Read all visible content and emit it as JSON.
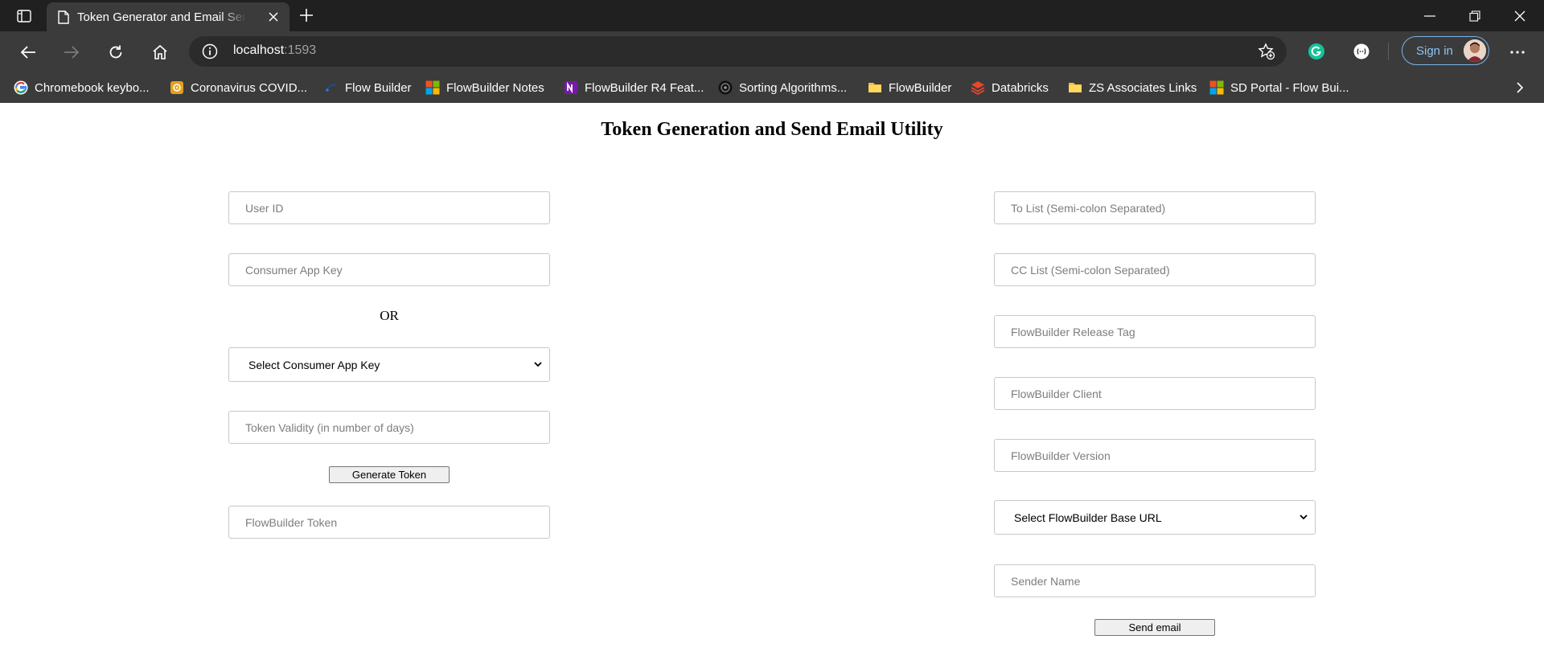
{
  "browser": {
    "tab": {
      "title": "Token Generator and Email Sender"
    },
    "address": {
      "host": "localhost",
      "port": ":1593"
    },
    "signin_label": "Sign in",
    "bookmarks": [
      {
        "label": "Chromebook keybo...",
        "icon": "google-icon"
      },
      {
        "label": "Coronavirus COVID...",
        "icon": "covid-icon"
      },
      {
        "label": "Flow Builder",
        "icon": "flow-builder-icon"
      },
      {
        "label": "FlowBuilder Notes",
        "icon": "microsoft-icon"
      },
      {
        "label": "FlowBuilder R4 Feat...",
        "icon": "onenote-icon"
      },
      {
        "label": "Sorting Algorithms...",
        "icon": "sorting-icon"
      },
      {
        "label": "FlowBuilder",
        "icon": "folder-icon"
      },
      {
        "label": "Databricks",
        "icon": "databricks-icon"
      },
      {
        "label": "ZS Associates Links",
        "icon": "folder-icon"
      },
      {
        "label": "SD Portal - Flow Bui...",
        "icon": "microsoft-icon"
      }
    ]
  },
  "page": {
    "title": "Token Generation and Send Email Utility",
    "left": {
      "user_id_placeholder": "User ID",
      "consumer_key_placeholder": "Consumer App Key",
      "or_label": "OR",
      "select_consumer_key": "Select Consumer App Key",
      "token_validity_placeholder": "Token Validity (in number of days)",
      "generate_button": "Generate Token",
      "token_placeholder": "FlowBuilder Token"
    },
    "right": {
      "to_list_placeholder": "To List (Semi-colon Separated)",
      "cc_list_placeholder": "CC List (Semi-colon Separated)",
      "release_tag_placeholder": "FlowBuilder Release Tag",
      "client_placeholder": "FlowBuilder Client",
      "version_placeholder": "FlowBuilder Version",
      "select_base_url": "Select FlowBuilder Base URL",
      "sender_name_placeholder": "Sender Name",
      "send_button": "Send email"
    }
  },
  "colors": {
    "chrome_dark": "#202020",
    "chrome": "#3b3b3b",
    "signin_accent": "#7ab3e8"
  }
}
